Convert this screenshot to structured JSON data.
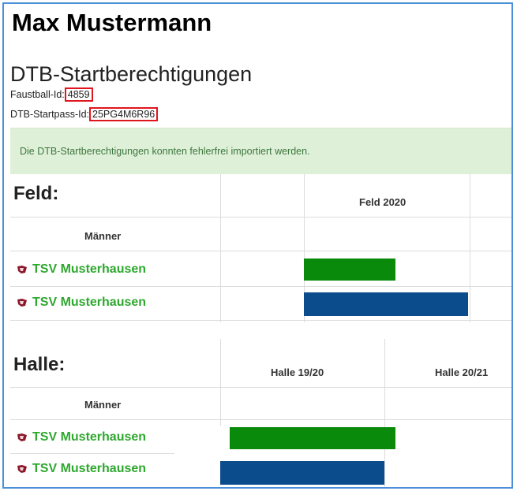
{
  "person": {
    "name": "Max Mustermann"
  },
  "page": {
    "subtitle": "DTB-Startberechtigungen"
  },
  "ids": {
    "faustball_label": "Faustball-Id:",
    "faustball_value": "4859",
    "startpass_label": "DTB-Startpass-Id:",
    "startpass_value": "25PG4M6R96"
  },
  "alert": {
    "message": "Die DTB-Startberechtigungen konnten fehlerfrei importiert werden."
  },
  "feld": {
    "heading": "Feld:",
    "season": "Feld 2020",
    "group": "Männer",
    "teams": [
      {
        "club": "TSV Musterhausen",
        "status": "active",
        "color": "#0a8a0a"
      },
      {
        "club": "TSV Musterhausen",
        "status": "full",
        "color": "#0b4c8c"
      }
    ]
  },
  "halle": {
    "heading": "Halle:",
    "seasons": [
      "Halle 19/20",
      "Halle 20/21"
    ],
    "group": "Männer",
    "teams": [
      {
        "club": "TSV Musterhausen",
        "status": "active",
        "color": "#0a8a0a"
      },
      {
        "club": "TSV Musterhausen",
        "status": "full",
        "color": "#0b4c8c"
      }
    ]
  },
  "icons": {
    "club_logo": "club-logo-icon"
  }
}
